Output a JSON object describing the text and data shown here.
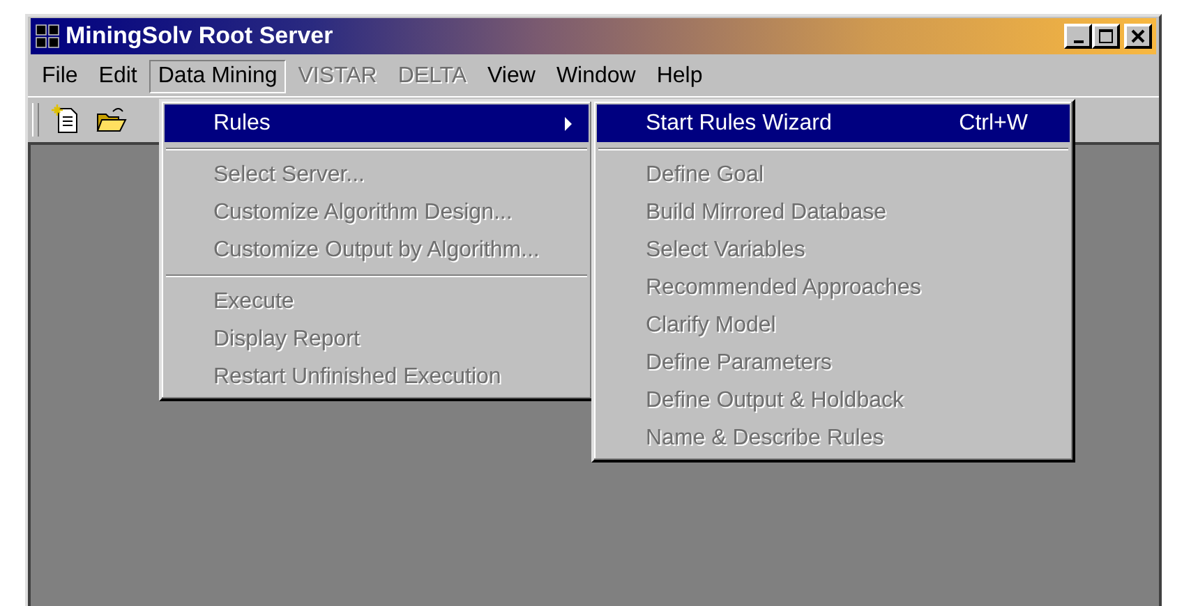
{
  "window": {
    "title": "MiningSolv Root Server"
  },
  "menubar": [
    {
      "label": "File",
      "disabled": false,
      "selected": false
    },
    {
      "label": "Edit",
      "disabled": false,
      "selected": false
    },
    {
      "label": "Data Mining",
      "disabled": false,
      "selected": true
    },
    {
      "label": "VISTAR",
      "disabled": true,
      "selected": false
    },
    {
      "label": "DELTA",
      "disabled": true,
      "selected": false
    },
    {
      "label": "View",
      "disabled": false,
      "selected": false
    },
    {
      "label": "Window",
      "disabled": false,
      "selected": false
    },
    {
      "label": "Help",
      "disabled": false,
      "selected": false
    }
  ],
  "data_mining_menu": [
    {
      "kind": "item",
      "label": "Rules",
      "selected": true,
      "disabled": false,
      "submenu": true
    },
    {
      "kind": "separator"
    },
    {
      "kind": "item",
      "label": "Select Server...",
      "selected": false,
      "disabled": true,
      "submenu": false
    },
    {
      "kind": "item",
      "label": "Customize Algorithm Design...",
      "selected": false,
      "disabled": true,
      "submenu": false
    },
    {
      "kind": "item",
      "label": "Customize Output by Algorithm...",
      "selected": false,
      "disabled": true,
      "submenu": false
    },
    {
      "kind": "separator"
    },
    {
      "kind": "item",
      "label": "Execute",
      "selected": false,
      "disabled": true,
      "submenu": false
    },
    {
      "kind": "item",
      "label": "Display Report",
      "selected": false,
      "disabled": true,
      "submenu": false
    },
    {
      "kind": "item",
      "label": "Restart Unfinished Execution",
      "selected": false,
      "disabled": true,
      "submenu": false
    }
  ],
  "rules_submenu": [
    {
      "kind": "item",
      "label": "Start Rules Wizard",
      "shortcut": "Ctrl+W",
      "selected": true,
      "disabled": false
    },
    {
      "kind": "separator"
    },
    {
      "kind": "item",
      "label": "Define Goal",
      "selected": false,
      "disabled": true
    },
    {
      "kind": "item",
      "label": "Build Mirrored Database",
      "selected": false,
      "disabled": true
    },
    {
      "kind": "item",
      "label": "Select Variables",
      "selected": false,
      "disabled": true
    },
    {
      "kind": "item",
      "label": "Recommended Approaches",
      "selected": false,
      "disabled": true
    },
    {
      "kind": "item",
      "label": "Clarify Model",
      "selected": false,
      "disabled": true
    },
    {
      "kind": "item",
      "label": "Define Parameters",
      "selected": false,
      "disabled": true
    },
    {
      "kind": "item",
      "label": "Define Output & Holdback",
      "selected": false,
      "disabled": true
    },
    {
      "kind": "item",
      "label": "Name & Describe Rules",
      "selected": false,
      "disabled": true
    }
  ]
}
